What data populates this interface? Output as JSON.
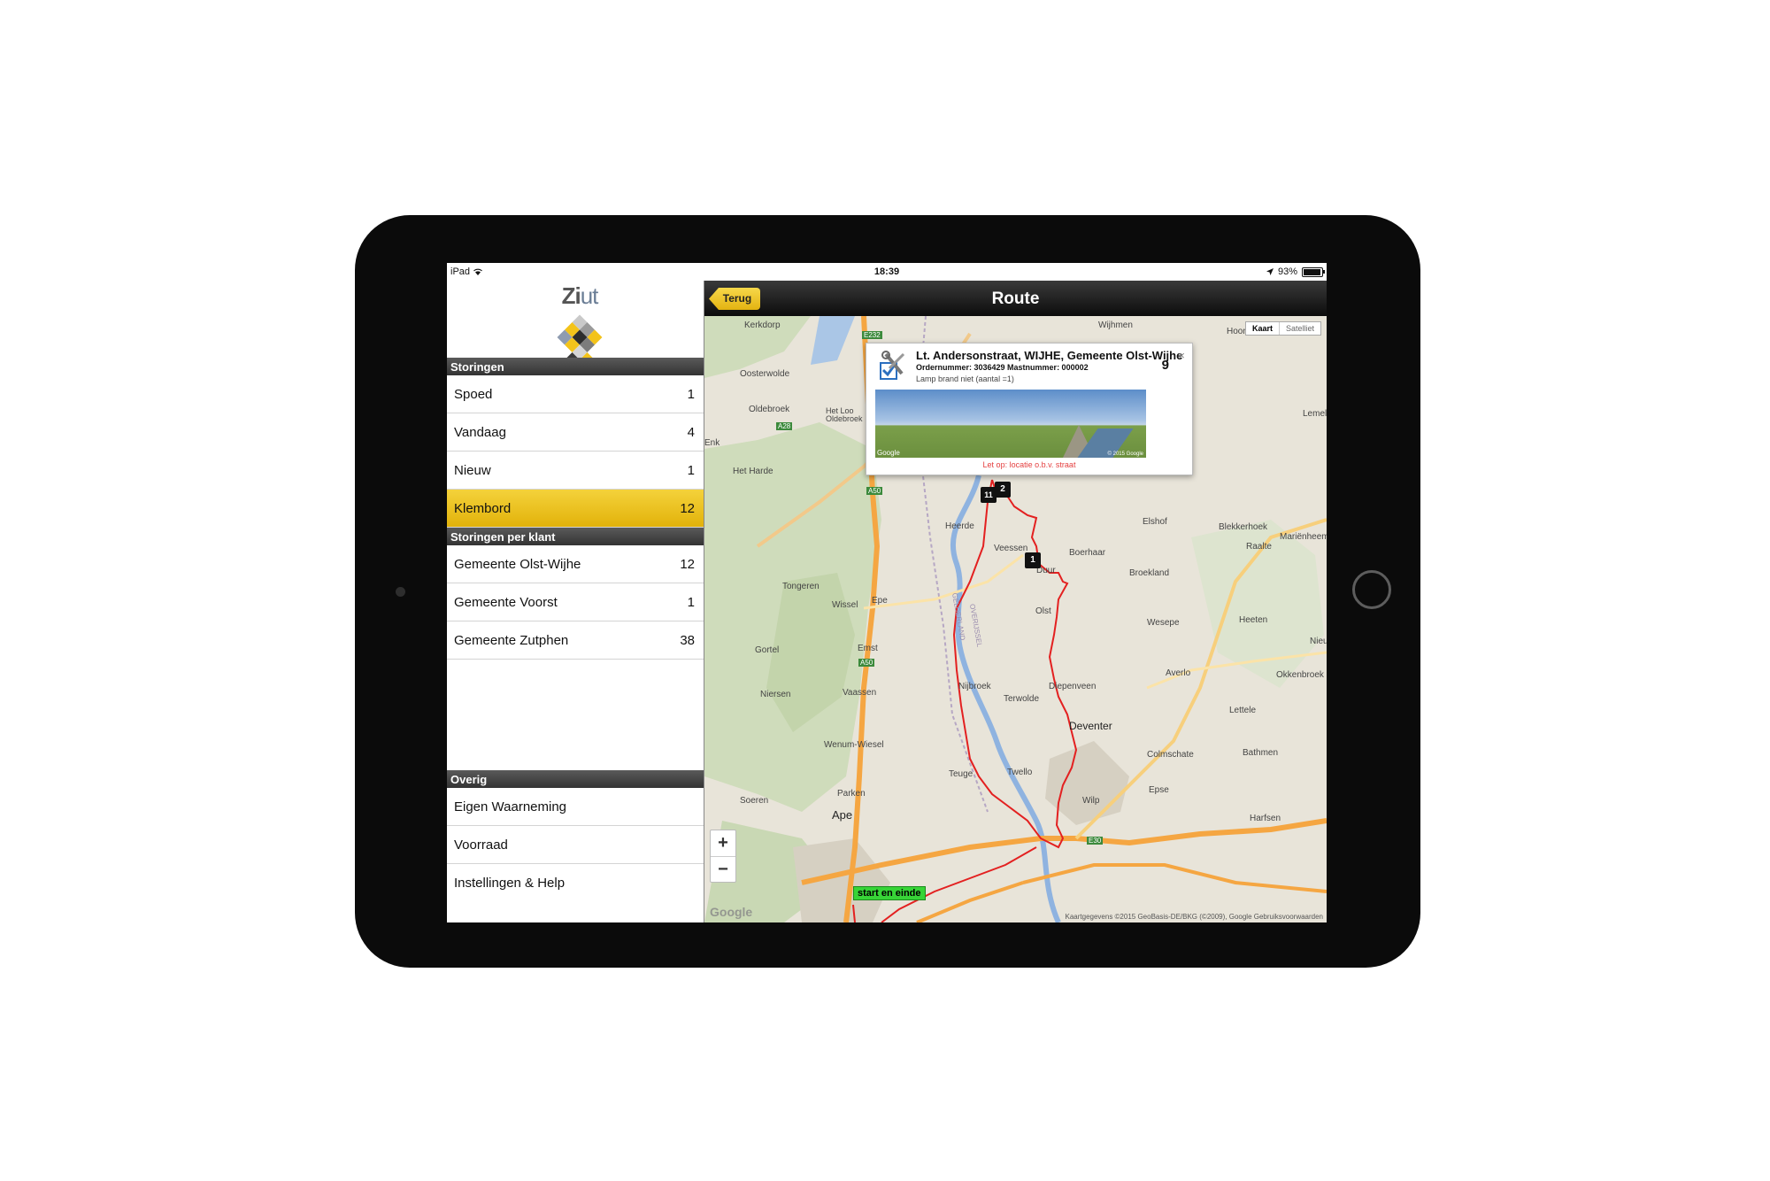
{
  "statusbar": {
    "device": "iPad",
    "time": "18:39",
    "battery": "93%"
  },
  "logo": {
    "text_a": "Zi",
    "text_b": "ut"
  },
  "sidebar": {
    "sections": [
      {
        "header": "Storingen",
        "items": [
          {
            "label": "Spoed",
            "count": "1"
          },
          {
            "label": "Vandaag",
            "count": "4"
          },
          {
            "label": "Nieuw",
            "count": "1"
          },
          {
            "label": "Klembord",
            "count": "12",
            "selected": true
          }
        ]
      },
      {
        "header": "Storingen per klant",
        "items": [
          {
            "label": "Gemeente Olst-Wijhe",
            "count": "12"
          },
          {
            "label": "Gemeente Voorst",
            "count": "1"
          },
          {
            "label": "Gemeente Zutphen",
            "count": "38"
          }
        ]
      },
      {
        "header": "Overig",
        "items": [
          {
            "label": "Eigen Waarneming"
          },
          {
            "label": "Voorraad"
          },
          {
            "label": "Instellingen & Help"
          }
        ]
      }
    ]
  },
  "navbar": {
    "back_label": "Terug",
    "title": "Route"
  },
  "map": {
    "type_active": "Kaart",
    "type_inactive": "Satelliet",
    "zoom_in": "+",
    "zoom_out": "−",
    "google": "Google",
    "attribution": "Kaartgegevens ©2015 GeoBasis-DE/BKG (©2009), Google   Gebruiksvoorwaarden",
    "start_label": "start en einde",
    "places": {
      "kerkdorp": "Kerkdorp",
      "wijhmen": "Wijhmen",
      "hoonhorst": "Hoonhorst",
      "oosterwolde": "Oosterwolde",
      "oldebroek": "Oldebroek",
      "hetloo": "Het Loo\nOldebroek",
      "lemele": "Lemele",
      "enk": "Enk",
      "hetharde": "Het Harde",
      "heerde": "Heerde",
      "elshof": "Elshof",
      "blekkerhoek": "Blekkerhoek",
      "raalte": "Raalte",
      "marienheem": "Mariënheem",
      "veessen": "Veessen",
      "boerhaar": "Boerhaar",
      "broekland": "Broekland",
      "duur": "Duur",
      "tongeren": "Tongeren",
      "epe": "Epe",
      "wissel": "Wissel",
      "olst": "Olst",
      "wesepe": "Wesepe",
      "heeten": "Heeten",
      "nieu": "Nieu",
      "gortel": "Gortel",
      "emst": "Emst",
      "averlo": "Averlo",
      "okkenbroek": "Okkenbroek",
      "nijbroek": "Nijbroek",
      "diepenveen": "Diepenveen",
      "niersen": "Niersen",
      "vaassen": "Vaassen",
      "terwolde": "Terwolde",
      "lettele": "Lettele",
      "deventer": "Deventer",
      "wenumwiesel": "Wenum-Wiesel",
      "colmschate": "Colmschate",
      "bathmen": "Bathmen",
      "teuge": "Teuge",
      "twello": "Twello",
      "epse": "Epse",
      "soeren": "Soeren",
      "parken": "Parken",
      "wilp": "Wilp",
      "apeldoorn": "Ape",
      "harfsen": "Harfsen",
      "gelderland": "GELDERLAND",
      "overijssel": "OVERIJSSEL"
    },
    "roads": {
      "a28": "A28",
      "a50a": "A50",
      "a50b": "A50",
      "e232": "E232",
      "e30": "E30"
    },
    "markers": [
      "1",
      "2",
      "11"
    ]
  },
  "infowindow": {
    "address": "Lt. Andersonstraat, WIJHE, Gemeente Olst-Wijhe",
    "meta": "Ordernummer: 3036429  Mastnummer: 000002",
    "description": "Lamp brand niet (aantal =1)",
    "number": "9",
    "close": "×",
    "photo_google": "Google",
    "photo_copyright": "© 2015 Google",
    "warning": "Let op: locatie o.b.v. straat"
  },
  "colors": {
    "accent": "#f2c419",
    "route": "#e32020",
    "start_label": "#37d437"
  }
}
